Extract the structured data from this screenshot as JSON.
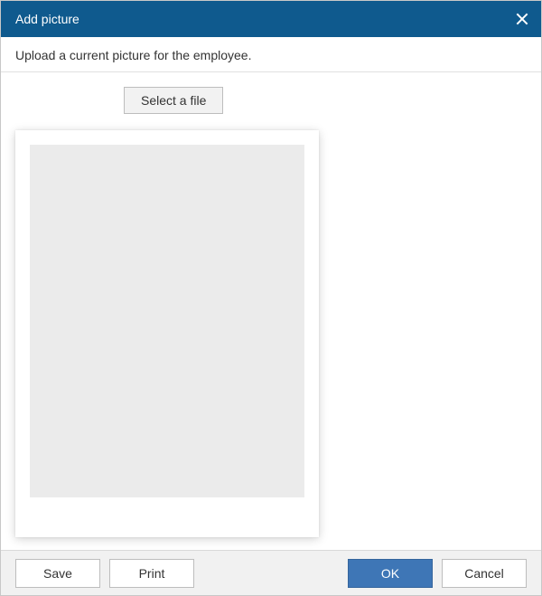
{
  "dialog": {
    "title": "Add picture",
    "instruction": "Upload a current picture for the employee.",
    "select_file_label": "Select a file"
  },
  "footer": {
    "save": "Save",
    "print": "Print",
    "ok": "OK",
    "cancel": "Cancel"
  }
}
